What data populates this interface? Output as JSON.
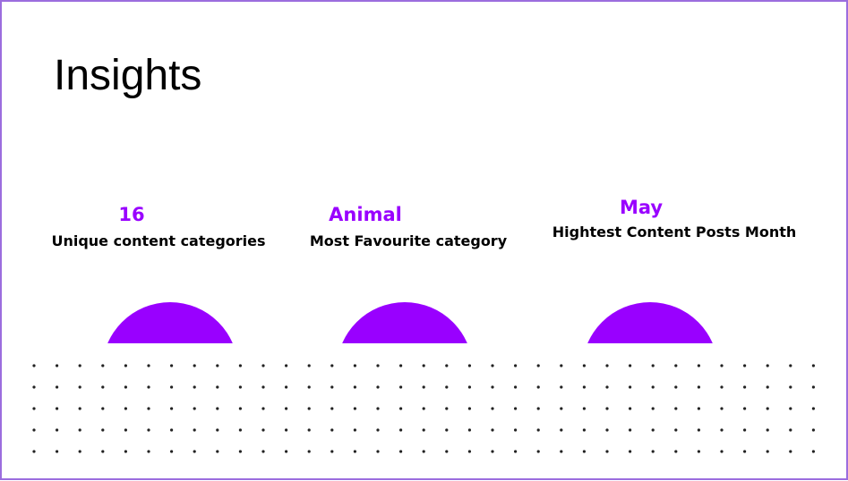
{
  "title": "Insights",
  "stats": [
    {
      "value": "16",
      "label": "Unique content categories"
    },
    {
      "value": "Animal",
      "label": "Most Favourite category"
    },
    {
      "value": "May",
      "label": "Hightest Content Posts Month"
    }
  ],
  "colors": {
    "accent": "#9900ff",
    "border": "#9b6dde",
    "text": "#000000",
    "dots": "#222222"
  }
}
